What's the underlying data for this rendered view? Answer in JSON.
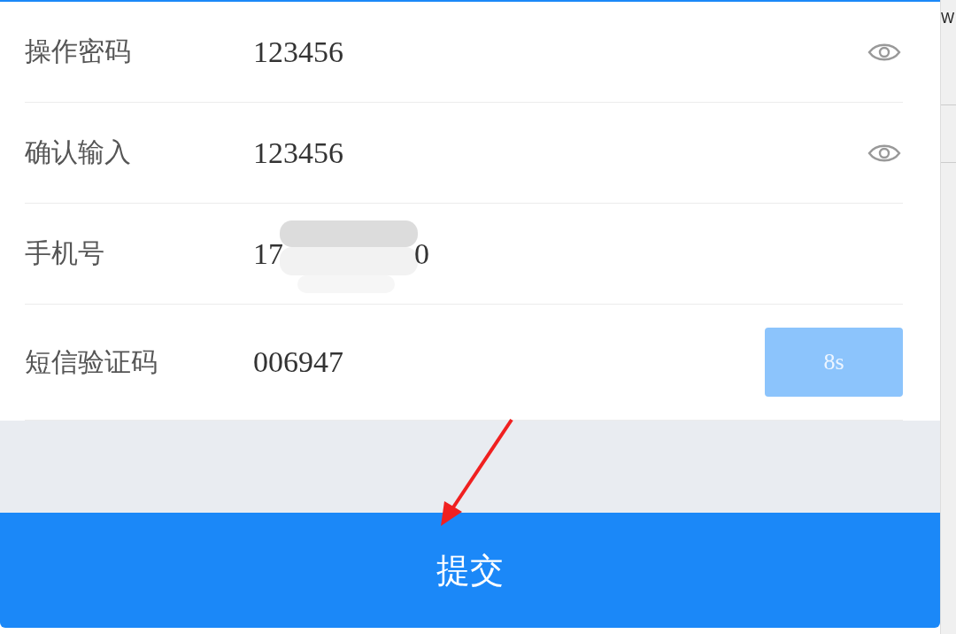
{
  "form": {
    "rows": [
      {
        "kind": "password",
        "label": "操作密码",
        "value": "123456"
      },
      {
        "kind": "password",
        "label": "确认输入",
        "value": "123456"
      },
      {
        "kind": "masked",
        "label": "手机号",
        "value_parts": [
          "17",
          "0"
        ]
      },
      {
        "kind": "code",
        "label": "短信验证码",
        "value": "006947",
        "button": {
          "label": "8s",
          "disabled": true
        }
      }
    ]
  },
  "submit_button": {
    "label": "提交"
  },
  "annotation": {
    "kind": "arrow"
  },
  "side_window": {
    "text": "W"
  }
}
